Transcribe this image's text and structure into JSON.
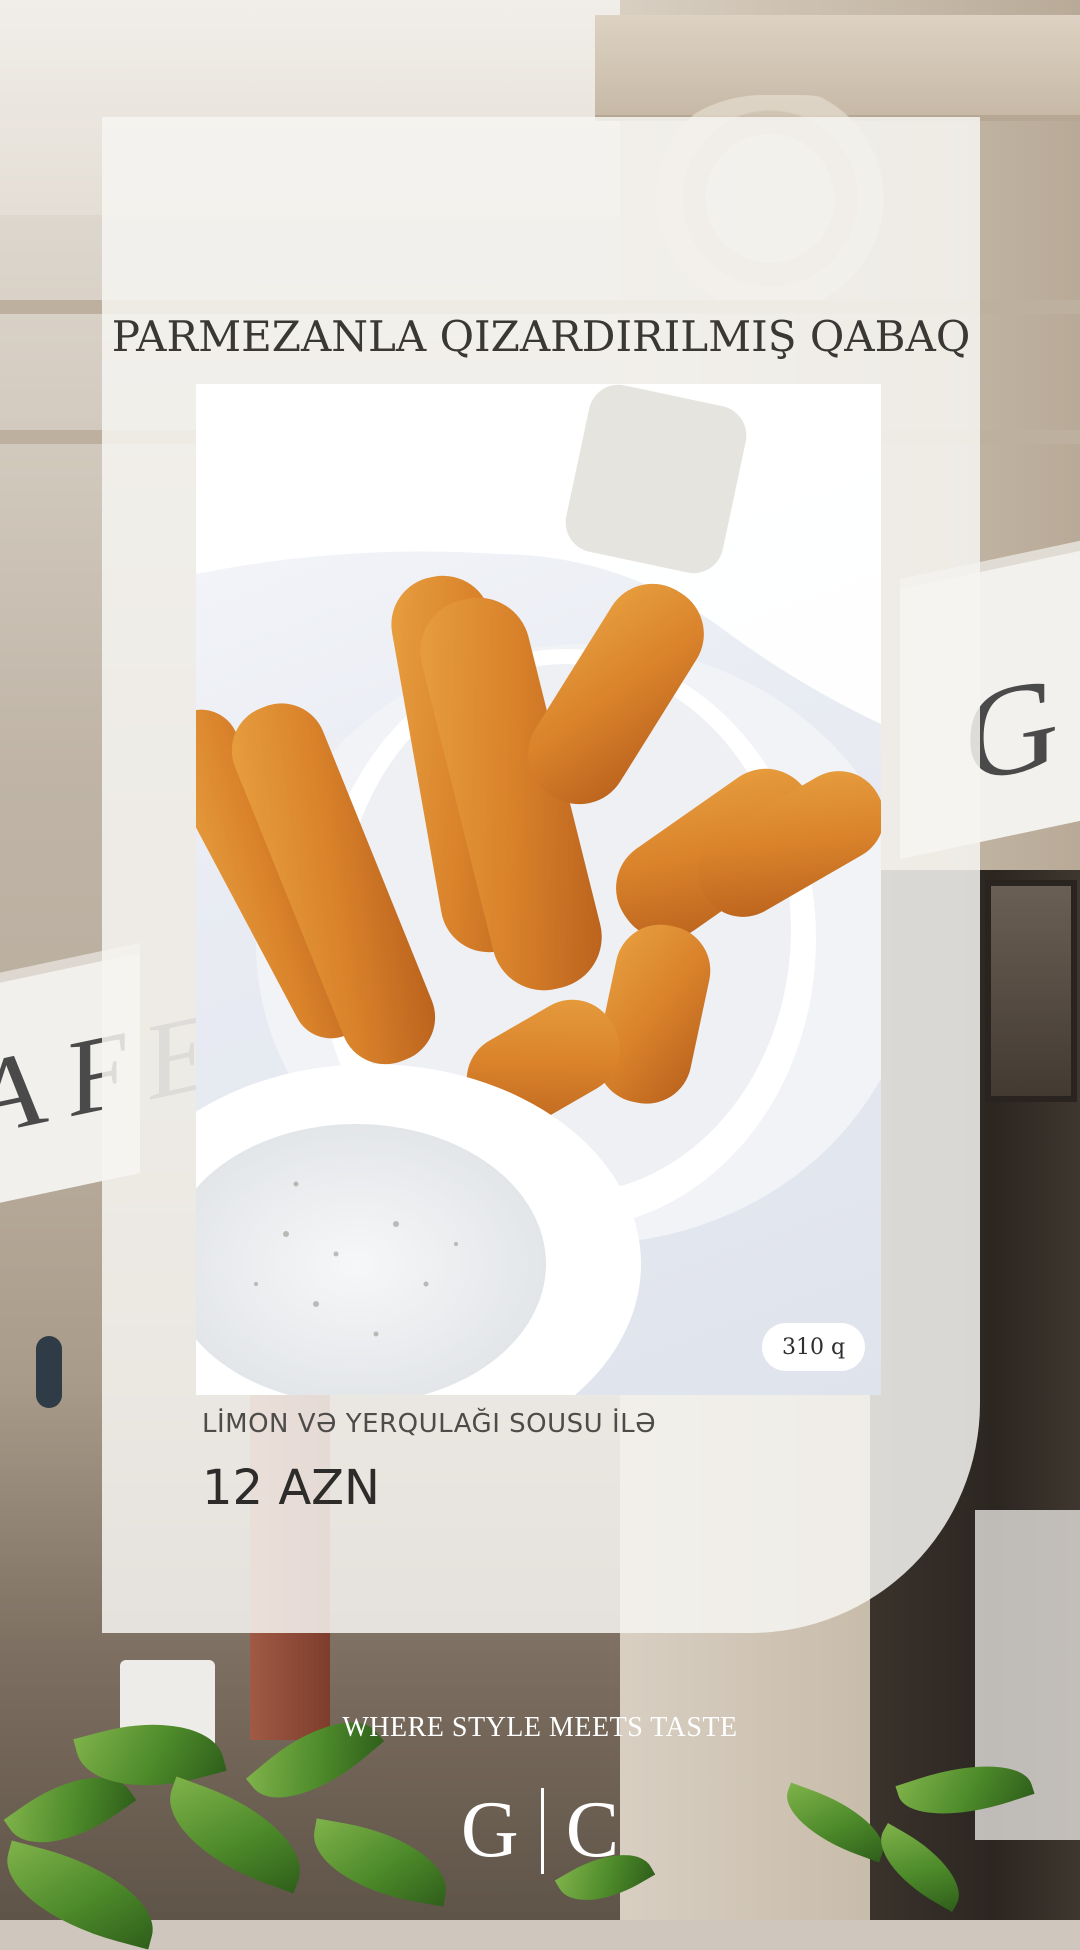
{
  "dish": {
    "title": "PARMEZANLA QIZARDIRILMIŞ QABAQ",
    "subtitle": "LİMON VƏ YERQULAĞI SOUSU İLƏ",
    "price": "12 AZN",
    "weight": "310 q"
  },
  "background": {
    "awning_right_text": "GA",
    "awning_left_text": "AFE"
  },
  "brand": {
    "tagline": "WHERE STYLE MEETS TASTE",
    "logo_left": "G",
    "logo_right": "C"
  },
  "colors": {
    "card": "#f6f4f1",
    "title_text": "#3a3835",
    "fried_food": "#d9822b",
    "sauce": "#eef0f2",
    "leaf_green": "#4d8a2a"
  },
  "icons": {
    "logo": "gc-monogram"
  }
}
